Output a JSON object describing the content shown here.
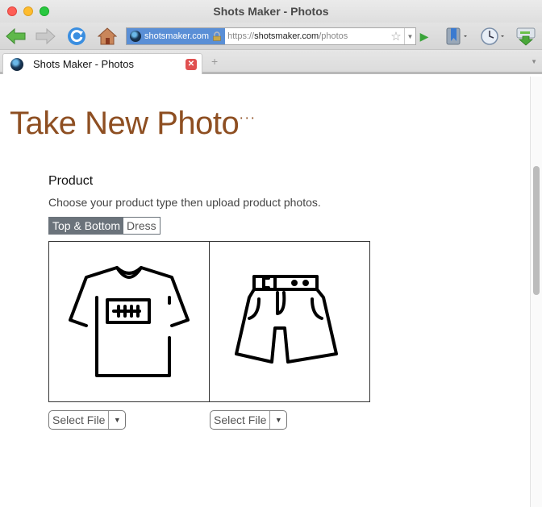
{
  "window": {
    "title": "Shots Maker - Photos"
  },
  "toolbar": {
    "back_icon": "back-arrow-icon",
    "forward_icon": "forward-arrow-icon",
    "reload_icon": "reload-icon",
    "home_icon": "home-icon",
    "site_identity": "shotsmaker.com",
    "url_scheme": "https://",
    "url_host": "shotsmaker.com",
    "url_path": "/photos",
    "go_icon": "go-arrow-icon",
    "bookmarks_icon": "bookmarks-icon",
    "history_icon": "history-clock-icon",
    "downloads_icon": "downloads-icon"
  },
  "tabs": [
    {
      "label": "Shots Maker - Photos",
      "active": true
    }
  ],
  "page": {
    "title": "Take New Photo",
    "title_suffix": "···",
    "section_title": "Product",
    "section_desc": "Choose your product type then upload product photos.",
    "product_types": [
      {
        "label": "Top & Bottom",
        "selected": true
      },
      {
        "label": "Dress",
        "selected": false
      }
    ],
    "slots": [
      {
        "image": "t-shirt-icon",
        "select_label": "Select File"
      },
      {
        "image": "shorts-icon",
        "select_label": "Select File"
      }
    ]
  },
  "colors": {
    "title": "#8e4f22",
    "segment_active": "#6b737b",
    "site_identity_bg": "#5a8fd6"
  }
}
